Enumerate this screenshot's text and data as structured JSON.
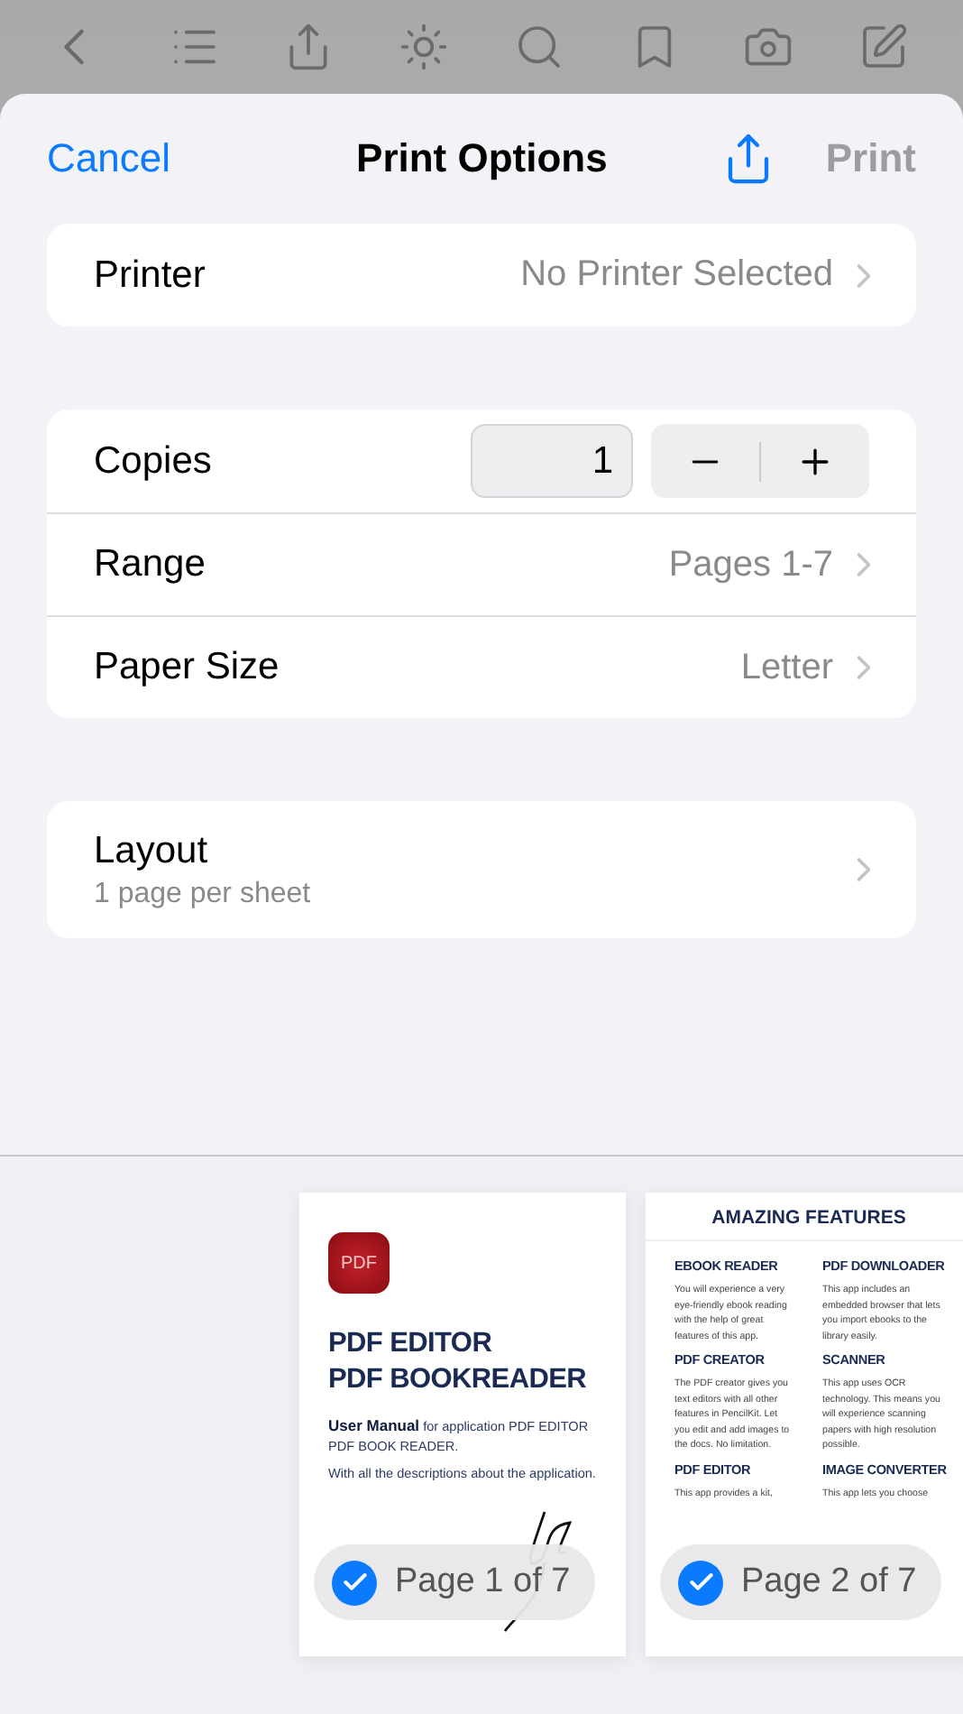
{
  "header": {
    "cancel": "Cancel",
    "title": "Print Options",
    "print": {
      "label": "Print",
      "disabled": true
    }
  },
  "printer": {
    "label": "Printer",
    "value": "No Printer Selected"
  },
  "copies": {
    "label": "Copies",
    "value": "1"
  },
  "settings": [
    {
      "label": "Range",
      "value": "Pages 1-7"
    },
    {
      "label": "Paper Size",
      "value": "Letter"
    }
  ],
  "layout": {
    "label": "Layout",
    "subtitle": "1 page per sheet"
  },
  "pages": [
    {
      "kind": "cover",
      "app_icon": "PDF",
      "title_lines": [
        "PDF EDITOR",
        "PDF BOOKREADER"
      ],
      "paragraphs": [
        "**User Manual** for application PDF EDITOR PDF BOOK READER.",
        "With all the descriptions about the application."
      ],
      "badge": "Page 1 of 7",
      "selected": true
    },
    {
      "kind": "features",
      "heading": "AMAZING FEATURES",
      "features": [
        {
          "title": "EBOOK READER",
          "text": "You will experience a very eye-friendly ebook reading with the help of great features of this app."
        },
        {
          "title": "PDF DOWNLOADER",
          "text": "This app includes an embedded browser that lets you import ebooks to the library easily."
        },
        {
          "title": "PDF CREATOR",
          "text": "The PDF creator gives you text editors with all other features in PencilKit. Let you edit and add images to the docs. No limitation."
        },
        {
          "title": "SCANNER",
          "text": "This app uses OCR technology. This means you will experience scanning papers with high resolution possible."
        },
        {
          "title": "PDF EDITOR",
          "text": "This app provides a kit,"
        },
        {
          "title": "IMAGE CONVERTER",
          "text": "This app lets you choose"
        }
      ],
      "badge": "Page 2 of 7",
      "selected": true
    }
  ]
}
